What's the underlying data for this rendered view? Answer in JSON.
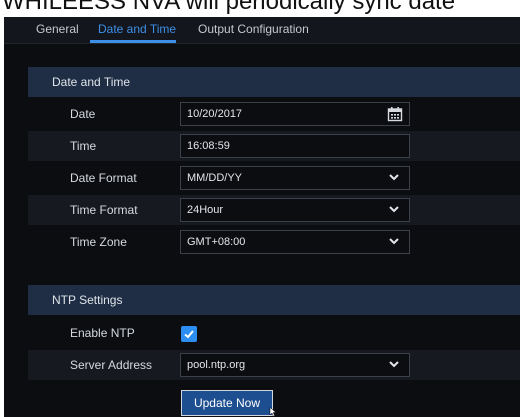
{
  "caption": "WHILEESS NVA will periodically sync date",
  "tabs": [
    {
      "label": "General"
    },
    {
      "label": "Date and Time"
    },
    {
      "label": "Output Configuration"
    }
  ],
  "date_time": {
    "header": "Date and Time",
    "date_label": "Date",
    "date_value": "10/20/2017",
    "time_label": "Time",
    "time_value": "16:08:59",
    "date_format_label": "Date Format",
    "date_format_value": "MM/DD/YY",
    "time_format_label": "Time Format",
    "time_format_value": "24Hour",
    "time_zone_label": "Time Zone",
    "time_zone_value": "GMT+08:00"
  },
  "ntp": {
    "header": "NTP Settings",
    "enable_label": "Enable NTP",
    "enabled": true,
    "server_label": "Server Address",
    "server_value": "pool.ntp.org",
    "update_button": "Update Now"
  },
  "colors": {
    "accent": "#3d8fe8",
    "section_header": "#1f2e44",
    "checkbox": "#2b8ef0",
    "button": "#1d4e8f"
  }
}
